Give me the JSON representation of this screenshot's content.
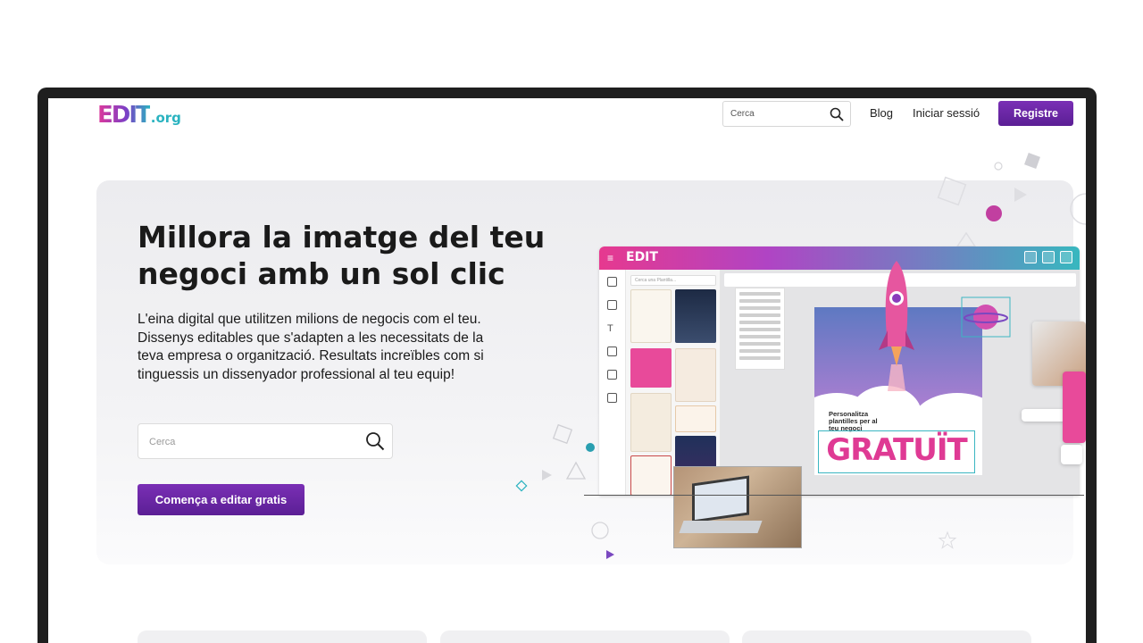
{
  "header": {
    "logo_main": "EDIT",
    "logo_suffix": ".org",
    "search_placeholder": "Cerca",
    "nav": [
      {
        "label": "Blog"
      },
      {
        "label": "Iniciar sessió"
      }
    ],
    "register_label": "Registre"
  },
  "hero": {
    "title": "Millora la imatge del teu negoci amb un sol clic",
    "description": "L'eina digital que utilitzen milions de negocis com el teu. Dissenys editables que s'adapten a les necessitats de la teva empresa o organització. Resultats increïbles com si tinguessis un dissenyador professional al teu equip!",
    "search_placeholder": "Cerca",
    "cta_label": "Comença a editar gratis"
  },
  "editor_mockup": {
    "logo": "EDIT",
    "panel_search": "Cerca una Plantilla...",
    "poster_text": "Personalitza plantilles per al teu negoci",
    "poster_headline": "GRATUÏT"
  },
  "colors": {
    "brand_purple": "#6a27a8",
    "brand_pink": "#df3a94",
    "brand_teal": "#2bb3c0"
  }
}
